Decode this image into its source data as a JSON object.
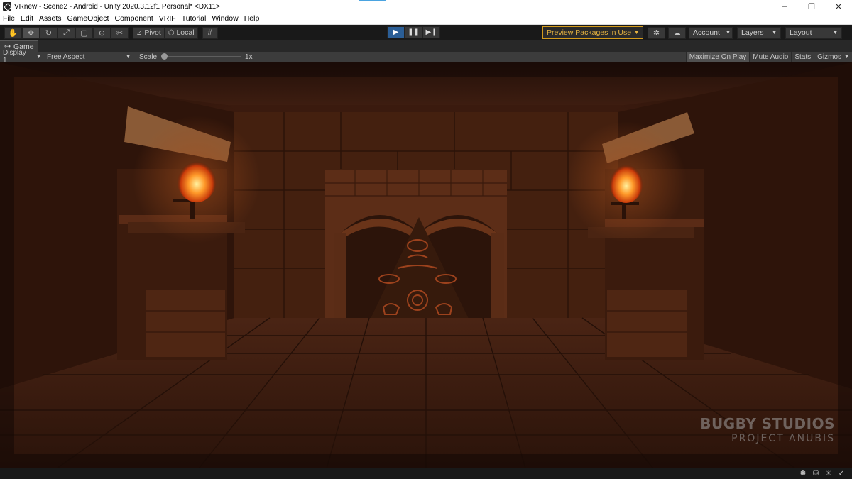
{
  "window": {
    "title": "VRnew - Scene2 - Android - Unity 2020.3.12f1 Personal* <DX11>",
    "controls": [
      "–",
      "❐",
      "✕"
    ]
  },
  "menu": [
    "File",
    "Edit",
    "Assets",
    "GameObject",
    "Component",
    "VRIF",
    "Tutorial",
    "Window",
    "Help"
  ],
  "toolbar": {
    "transform_tools": [
      "hand-icon",
      "move-icon",
      "rotate-icon",
      "scale-icon",
      "rect-icon",
      "transform-icon",
      "custom-tool-icon"
    ],
    "pivot_label": "Pivot",
    "local_label": "Local",
    "preview_packages_label": "Preview Packages in Use",
    "account_label": "Account",
    "layers_label": "Layers",
    "layout_label": "Layout"
  },
  "tabs": {
    "game_label": "Game"
  },
  "game_toolbar": {
    "display_label": "Display 1",
    "aspect_label": "Free Aspect",
    "scale_label": "Scale",
    "scale_value": "1x",
    "maximize_label": "Maximize On Play",
    "mute_label": "Mute Audio",
    "stats_label": "Stats",
    "gizmos_label": "Gizmos"
  },
  "watermark": {
    "line1": "BUGBY STUDIOS",
    "line2": "PROJECT ANUBIS"
  },
  "colors": {
    "accent_play": "#2b5e96",
    "preview_border": "#d49b1c",
    "scene_base": "#2a140c"
  }
}
